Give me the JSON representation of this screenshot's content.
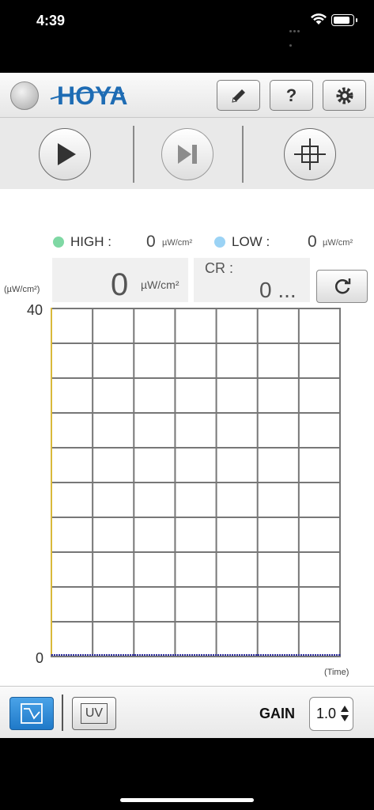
{
  "status": {
    "time": "4:39"
  },
  "topbar": {
    "brand": "HOYA",
    "help_label": "?"
  },
  "readings": {
    "high_label": "HIGH :",
    "high_value": "0",
    "high_unit": "µW/cm²",
    "low_label": "LOW :",
    "low_value": "0",
    "low_unit": "µW/cm²",
    "current_value": "0",
    "current_unit": "µW/cm²",
    "cr_label": "CR :",
    "cr_value": "0 ..."
  },
  "chart": {
    "y_unit": "(µW/cm²)",
    "y_max_label": "40",
    "y_min_label": "0",
    "x_unit": "(Time)"
  },
  "bottombar": {
    "uv_label": "UV",
    "gain_label": "GAIN",
    "gain_value": "1.0"
  },
  "colors": {
    "high_dot": "#7fd8a4",
    "low_dot": "#9bd3f5",
    "brand": "#1e6cb4",
    "active_button": "#2a86d4"
  },
  "chart_data": {
    "type": "line",
    "xlabel": "(Time)",
    "ylabel": "(µW/cm²)",
    "ylim": [
      0,
      40
    ],
    "grid": true,
    "series": [
      {
        "values": [
          0,
          0,
          0,
          0,
          0,
          0,
          0,
          0
        ],
        "color": "#2b2b9c"
      }
    ]
  }
}
